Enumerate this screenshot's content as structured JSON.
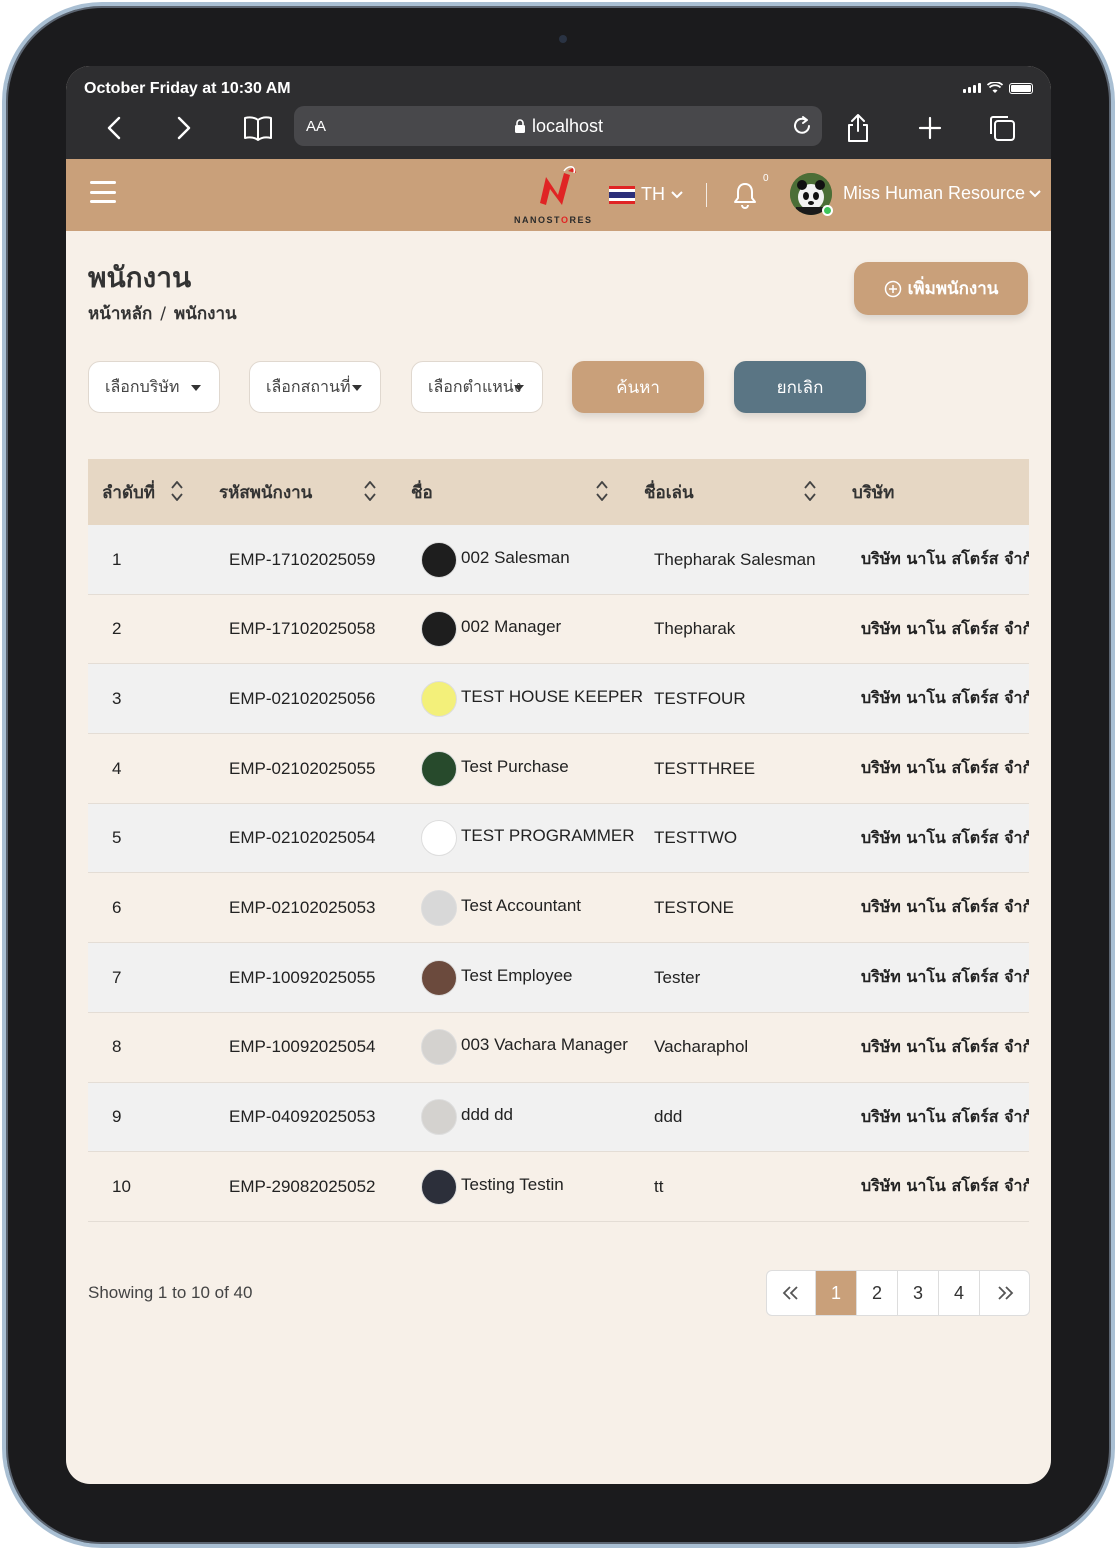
{
  "status_bar": {
    "time": "October Friday at 10:30 AM"
  },
  "browser": {
    "text_size": "AA",
    "url": "localhost"
  },
  "header": {
    "logo_text_a": "NANOST",
    "logo_text_b": "RES",
    "language": "TH",
    "notification_count": "0",
    "user_name": "Miss Human Resource"
  },
  "page": {
    "title": "พนักงาน",
    "breadcrumb": [
      "หน้าหลัก",
      "/",
      "พนักงาน"
    ],
    "add_button": "เพิ่มพนักงาน"
  },
  "filters": {
    "company": "เลือกบริษัท",
    "location": "เลือกสถานที่",
    "position": "เลือกตำแหน่ง",
    "search": "ค้นหา",
    "cancel": "ยกเลิก"
  },
  "table": {
    "headers": [
      "ลำดับที่",
      "รหัสพนักงาน",
      "ชื่อ",
      "ชื่อเล่น",
      "บริษัท"
    ],
    "rows": [
      {
        "no": "1",
        "code": "EMP-17102025059",
        "name": "002 Salesman",
        "nickname": "Thepharak Salesman",
        "company": "บริษัท นาโน สโตร์ส จำกั",
        "avatar_color": "#1e1e1e"
      },
      {
        "no": "2",
        "code": "EMP-17102025058",
        "name": "002 Manager",
        "nickname": "Thepharak",
        "company": "บริษัท นาโน สโตร์ส จำกั",
        "avatar_color": "#1e1e1e"
      },
      {
        "no": "3",
        "code": "EMP-02102025056",
        "name": "TEST HOUSE KEEPER",
        "nickname": "TESTFOUR",
        "company": "บริษัท นาโน สโตร์ส จำกั",
        "avatar_color": "#f3f07a"
      },
      {
        "no": "4",
        "code": "EMP-02102025055",
        "name": "Test Purchase",
        "nickname": "TESTTHREE",
        "company": "บริษัท นาโน สโตร์ส จำกั",
        "avatar_color": "#274a2c"
      },
      {
        "no": "5",
        "code": "EMP-02102025054",
        "name": "TEST PROGRAMMER",
        "nickname": "TESTTWO",
        "company": "บริษัท นาโน สโตร์ส จำกั",
        "avatar_color": "#ffffff"
      },
      {
        "no": "6",
        "code": "EMP-02102025053",
        "name": "Test Accountant",
        "nickname": "TESTONE",
        "company": "บริษัท นาโน สโตร์ส จำกั",
        "avatar_color": "#d8d8d8"
      },
      {
        "no": "7",
        "code": "EMP-10092025055",
        "name": "Test Employee",
        "nickname": "Tester",
        "company": "บริษัท นาโน สโตร์ส จำกั",
        "avatar_color": "#6b4a3d"
      },
      {
        "no": "8",
        "code": "EMP-10092025054",
        "name": "003 Vachara Manager",
        "nickname": "Vacharaphol",
        "company": "บริษัท นาโน สโตร์ส จำกั",
        "avatar_color": "#d4d2cf"
      },
      {
        "no": "9",
        "code": "EMP-04092025053",
        "name": "ddd dd",
        "nickname": "ddd",
        "company": "บริษัท นาโน สโตร์ส จำกั",
        "avatar_color": "#d4d2cf"
      },
      {
        "no": "10",
        "code": "EMP-29082025052",
        "name": "Testing Testin",
        "nickname": "tt",
        "company": "บริษัท นาโน สโตร์ส จำกั",
        "avatar_color": "#2c2f3a"
      }
    ]
  },
  "pagination": {
    "showing": "Showing 1 to 10 of 40",
    "first": "«",
    "pages": [
      "1",
      "2",
      "3",
      "4"
    ],
    "last": "»",
    "current": "1"
  },
  "colors": {
    "accent": "#c9a07a",
    "cancel": "#5a7584",
    "background": "#f7f0e8"
  }
}
